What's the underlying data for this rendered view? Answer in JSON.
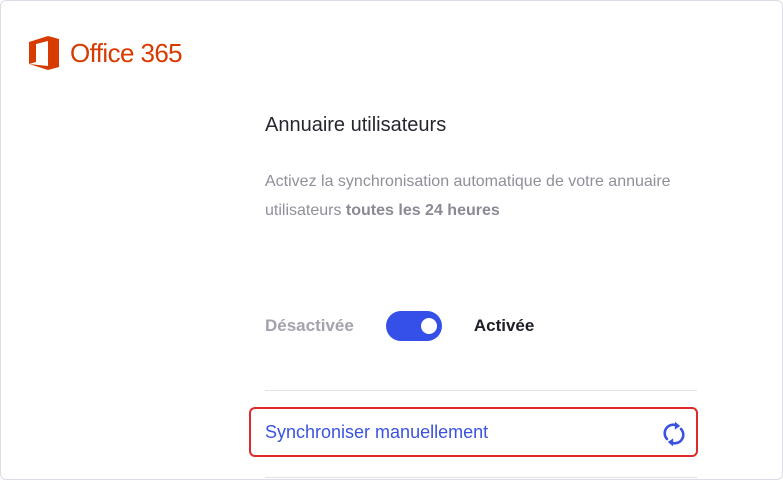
{
  "brand": {
    "logo_text": "Office 365",
    "color": "#d83b01"
  },
  "directory": {
    "title": "Annuaire utilisateurs",
    "description_prefix": "Activez la synchronisation automatique de votre annuaire utilisateurs ",
    "description_bold": "toutes les 24 heures"
  },
  "toggle": {
    "off_label": "Désactivée",
    "on_label": "Activée",
    "state": "on",
    "color": "#3550e8"
  },
  "sync": {
    "label": "Synchroniser manuellement",
    "icon": "sync-icon",
    "highlight_color": "#dd2b2b"
  }
}
